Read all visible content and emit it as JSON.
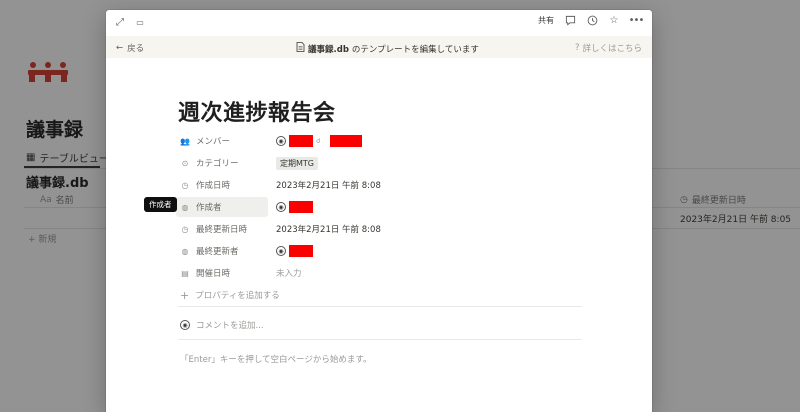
{
  "background": {
    "workspace_title": "議事録",
    "view_tab": "テーブルビュー",
    "database_title": "議事録.db",
    "columns": {
      "name": "名前",
      "last_edited": "最終更新日時"
    },
    "row": {
      "last_edited": "2023年2月21日 午前 8:05"
    },
    "new_label": "新規"
  },
  "topbar": {
    "share_label": "共有"
  },
  "template_bar": {
    "back_label": "戻る",
    "db_name": "議事録.db",
    "message": "のテンプレートを編集しています",
    "help_label": "詳しくはこちら"
  },
  "page": {
    "title": "週次進捗報告会",
    "properties": [
      {
        "key": "メンバー",
        "icon": "people-icon"
      },
      {
        "key": "カテゴリー",
        "icon": "select-icon",
        "value": "定期MTG"
      },
      {
        "key": "作成日時",
        "icon": "clock-icon",
        "value": "2023年2月21日 午前 8:08"
      },
      {
        "key": "作成者",
        "icon": "person-icon"
      },
      {
        "key": "最終更新日時",
        "icon": "clock-icon",
        "value": "2023年2月21日 午前 8:08"
      },
      {
        "key": "最終更新者",
        "icon": "person-icon"
      },
      {
        "key": "開催日時",
        "icon": "calendar-icon",
        "value": "未入力"
      }
    ],
    "add_property_label": "プロパティを追加する",
    "comment_placeholder": "コメントを追加...",
    "empty_hint": "「Enter」キーを押して空白ページから始めます。"
  },
  "tooltip": {
    "label": "作成者"
  },
  "colors": {
    "redaction": "#fa0000",
    "template_bar_bg": "#f7f5ef",
    "brand": "#c0392b"
  }
}
